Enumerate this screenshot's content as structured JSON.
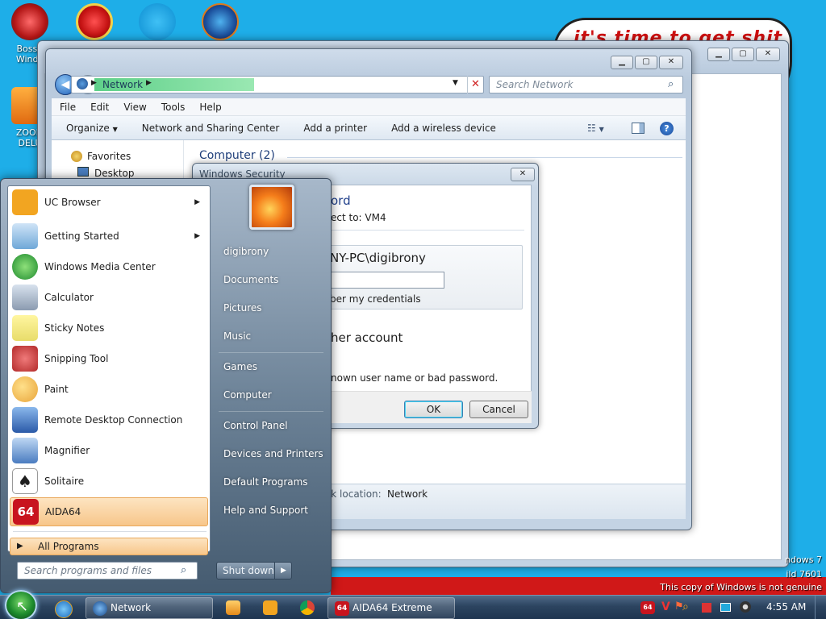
{
  "desktop": {
    "icons": [
      {
        "label": "BossK\nWindo"
      },
      {
        "label": "ZOOM\nDELU"
      }
    ],
    "background_text": "it's time to get shit",
    "watermark": {
      "line1": "ndows 7",
      "line2": "ild 7601",
      "line3": "This copy of Windows is not genuine"
    }
  },
  "explorer": {
    "breadcrumb": "Network",
    "search_placeholder": "Search Network",
    "menu": [
      "File",
      "Edit",
      "View",
      "Tools",
      "Help"
    ],
    "toolbar": {
      "organize": "Organize",
      "network_center": "Network and Sharing Center",
      "add_printer": "Add a printer",
      "add_wireless": "Add a wireless device"
    },
    "nav": {
      "favorites": "Favorites",
      "desktop": "Desktop"
    },
    "group_header": "Computer (2)",
    "status": {
      "label": "ork location:",
      "value": "Network"
    }
  },
  "dialog": {
    "title": "Windows Security",
    "heading": "ord",
    "subheading": "ect to: VM4",
    "account": "NY-PC\\digibrony",
    "remember": "ber my credentials",
    "other_account": "her account",
    "error": "nown user name or bad password.",
    "ok": "OK",
    "cancel": "Cancel"
  },
  "start_menu": {
    "programs": [
      {
        "label": "UC Browser",
        "submenu": true,
        "color": "#f2a521"
      },
      {
        "label": "Getting Started",
        "submenu": true,
        "color": "#6fa8d8"
      },
      {
        "label": "Windows Media Center",
        "submenu": false,
        "color": "#3aa33a"
      },
      {
        "label": "Calculator",
        "submenu": false,
        "color": "#8b9bb0"
      },
      {
        "label": "Sticky Notes",
        "submenu": false,
        "color": "#e8dc6a"
      },
      {
        "label": "Snipping Tool",
        "submenu": false,
        "color": "#d84a4a"
      },
      {
        "label": "Paint",
        "submenu": false,
        "color": "#e8a43a"
      },
      {
        "label": "Remote Desktop Connection",
        "submenu": false,
        "color": "#3a78c8"
      },
      {
        "label": "Magnifier",
        "submenu": false,
        "color": "#5a8fd0"
      },
      {
        "label": "Solitaire",
        "submenu": false,
        "color": "#f0f0f0"
      },
      {
        "label": "AIDA64",
        "submenu": false,
        "color": "#c8141e"
      }
    ],
    "all_programs": "All Programs",
    "search_placeholder": "Search programs and files",
    "right_items": [
      "digibrony",
      "Documents",
      "Pictures",
      "Music",
      "Games",
      "Computer",
      "Control Panel",
      "Devices and Printers",
      "Default Programs",
      "Help and Support"
    ],
    "shutdown": "Shut down"
  },
  "taskbar": {
    "network_btn": "Network",
    "aida_btn": "AIDA64 Extreme",
    "aida_icon_text": "64",
    "clock": "4:55 AM"
  }
}
